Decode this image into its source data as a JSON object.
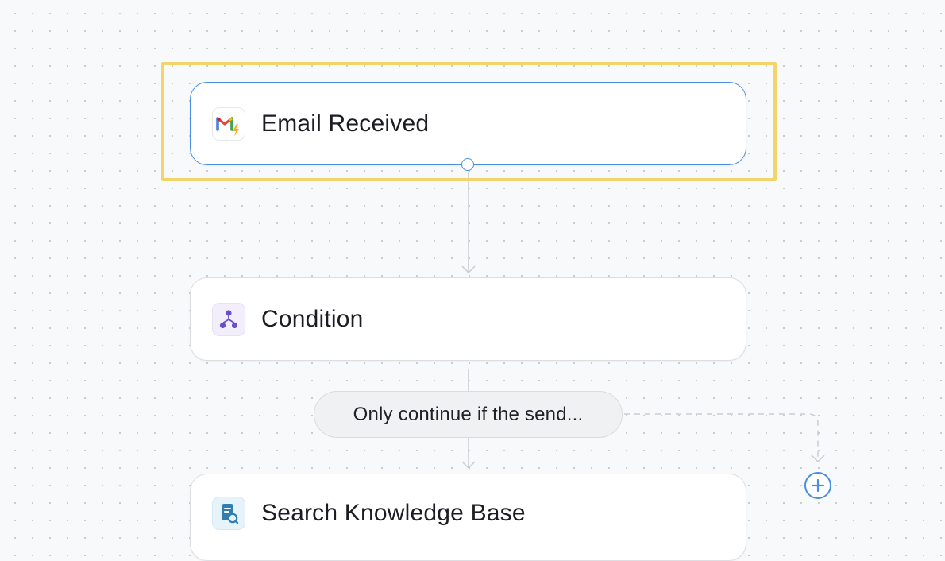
{
  "workflow": {
    "nodes": [
      {
        "label": "Email Received",
        "icon": "gmail-trigger-icon",
        "selected": true
      },
      {
        "label": "Condition",
        "icon": "branch-icon",
        "selected": false
      },
      {
        "label": "Search Knowledge Base",
        "icon": "knowledge-base-icon",
        "selected": false
      }
    ],
    "condition_pill": {
      "label": "Only continue if the send..."
    },
    "add_step": {
      "icon": "plus-circle-icon"
    }
  },
  "colors": {
    "selection_highlight": "#f3d46b",
    "selected_border": "#4a90e2",
    "accent": "#4a90e2",
    "connector": "#c9ccd1",
    "condition_icon": "#6b4fc9",
    "knowledge_icon": "#2f7fb5"
  }
}
